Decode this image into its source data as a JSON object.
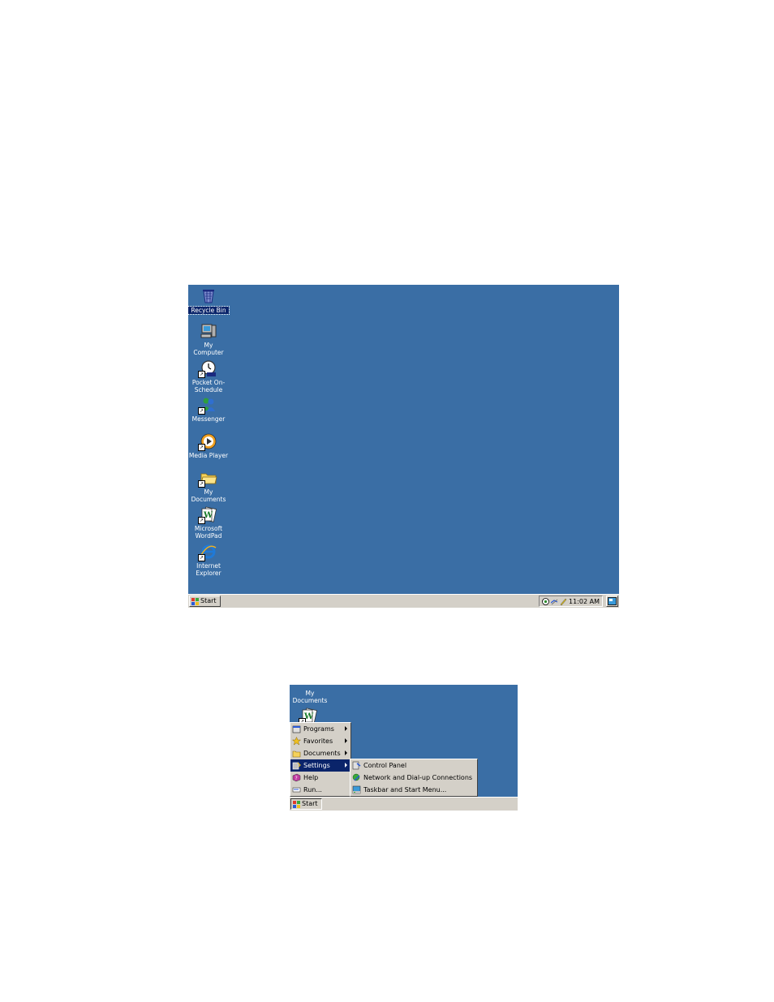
{
  "screen1": {
    "desktop_icons": [
      {
        "label": "Recycle Bin",
        "icon": "recycle-bin-icon",
        "selected": true,
        "shortcut": false
      },
      {
        "label": "My Computer",
        "icon": "my-computer-icon",
        "shortcut": false
      },
      {
        "label": "Pocket On-Schedule",
        "icon": "clock-icon",
        "shortcut": true
      },
      {
        "label": "Messenger",
        "icon": "messenger-icon",
        "shortcut": true
      },
      {
        "label": "Media Player",
        "icon": "media-player-icon",
        "shortcut": true
      },
      {
        "label": "My Documents",
        "icon": "folder-icon",
        "shortcut": true
      },
      {
        "label": "Microsoft WordPad",
        "icon": "wordpad-icon",
        "shortcut": true
      },
      {
        "label": "Internet Explorer",
        "icon": "internet-explorer-icon",
        "shortcut": true
      }
    ],
    "taskbar": {
      "start_label": "Start",
      "clock": "11:02 AM",
      "tray_icons": [
        "network-icon",
        "connection-icon",
        "pen-icon"
      ]
    }
  },
  "screen2": {
    "partial_icon_label": "My Documents",
    "start_menu": [
      {
        "label": "Programs",
        "accel": "P",
        "icon": "programs-icon",
        "submenu": true
      },
      {
        "label": "Favorites",
        "accel": "a",
        "icon": "favorites-icon",
        "submenu": true
      },
      {
        "label": "Documents",
        "accel": "D",
        "icon": "documents-icon",
        "submenu": true
      },
      {
        "label": "Settings",
        "accel": "S",
        "icon": "settings-icon",
        "submenu": true,
        "active": true
      },
      {
        "label": "Help",
        "accel": "H",
        "icon": "help-icon",
        "submenu": false
      },
      {
        "label": "Run...",
        "accel": "R",
        "icon": "run-icon",
        "submenu": false
      }
    ],
    "settings_submenu": [
      {
        "label": "Control Panel",
        "accel": "C",
        "icon": "control-panel-icon"
      },
      {
        "label": "Network and Dial-up Connections",
        "accel": "N",
        "icon": "network-connections-icon"
      },
      {
        "label": "Taskbar and Start Menu...",
        "accel": "T",
        "icon": "taskbar-settings-icon"
      }
    ],
    "taskbar": {
      "start_label": "Start"
    }
  },
  "colors": {
    "desktop": "#3a6ea5",
    "taskbar": "#d4d0c8",
    "highlight": "#0a246a"
  }
}
